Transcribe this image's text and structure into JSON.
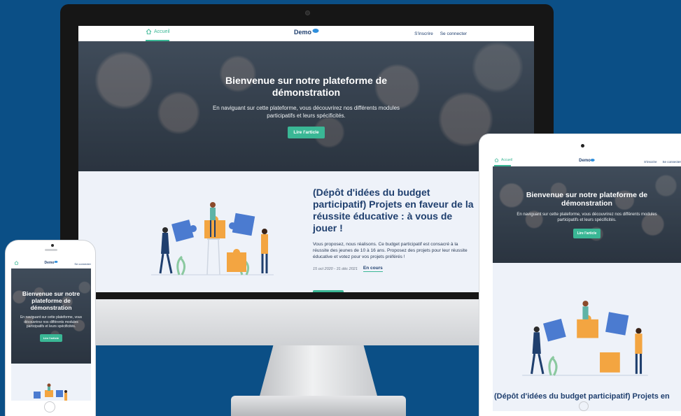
{
  "site": {
    "nav_home": "Accueil",
    "logo": "Demo",
    "nav_signup": "S'inscrire",
    "nav_login": "Se connecter"
  },
  "hero": {
    "title": "Bienvenue sur notre plateforme de démonstration",
    "subtitle": "En naviguant sur cette plateforme, vous découvrirez nos différents modules participatifs et leurs spécificités.",
    "cta": "Lire l'article"
  },
  "project": {
    "title": "(Dépôt d'idées du budget participatif) Projets en faveur de la réussite éducative : à vous de jouer !",
    "description": "Vous proposez, nous réalisons. Ce budget participatif est consacré à la réussite des jeunes de 10 à 16 ans. Proposez des projets pour leur réussite éducative et votez pour vos projets préférés !",
    "dates": "15 oct 2020 - 31 déc 2021",
    "status": "En cours"
  },
  "tablet": {
    "project_title": "(Dépôt d'idées du budget participatif) Projets en"
  },
  "colors": {
    "background": "#0b4f86",
    "accent": "#3ab795",
    "title": "#1f3f6e"
  },
  "icons": [
    "home-icon",
    "logo-bubble-icon",
    "puzzle-illustration"
  ]
}
